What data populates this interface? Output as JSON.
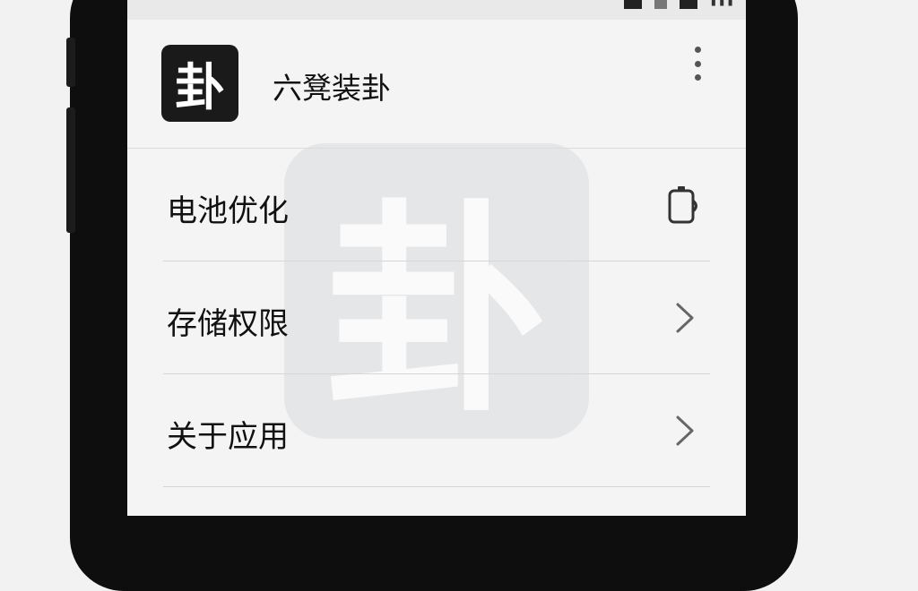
{
  "app": {
    "icon_glyph": "卦",
    "name": "六凳装卦"
  },
  "settings": {
    "items": [
      {
        "label": "电池优化",
        "icon": "battery-icon"
      },
      {
        "label": "存储权限",
        "icon": "chevron-right-icon"
      },
      {
        "label": "关于应用",
        "icon": "chevron-right-icon"
      }
    ]
  },
  "colors": {
    "screen_bg": "#f4f4f4",
    "phone_frame": "#0e0e0e",
    "app_icon_bg": "#1a1a1a"
  }
}
